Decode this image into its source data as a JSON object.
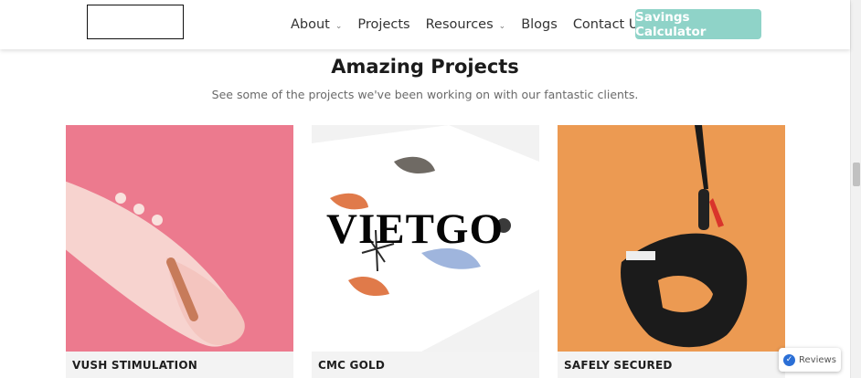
{
  "header": {
    "nav": [
      {
        "label": "About",
        "dropdown": true
      },
      {
        "label": "Projects",
        "dropdown": false
      },
      {
        "label": "Resources",
        "dropdown": true
      },
      {
        "label": "Blogs",
        "dropdown": false
      },
      {
        "label": "Contact Us",
        "dropdown": false
      }
    ],
    "cta_label": "Savings Calculator",
    "cta_color": "#8fd3c8"
  },
  "section": {
    "title": "Amazing Projects",
    "subtitle": "See some of the projects we've been working on with our fantastic clients."
  },
  "projects": [
    {
      "title": "VUSH STIMULATION",
      "bg": "#ec7a8e"
    },
    {
      "title": "CMC GOLD",
      "bg": "#f2f2f2"
    },
    {
      "title": "SAFELY SECURED",
      "bg": "#ec9a52"
    }
  ],
  "watermark": "VIETGO",
  "reviews_label": "Reviews"
}
